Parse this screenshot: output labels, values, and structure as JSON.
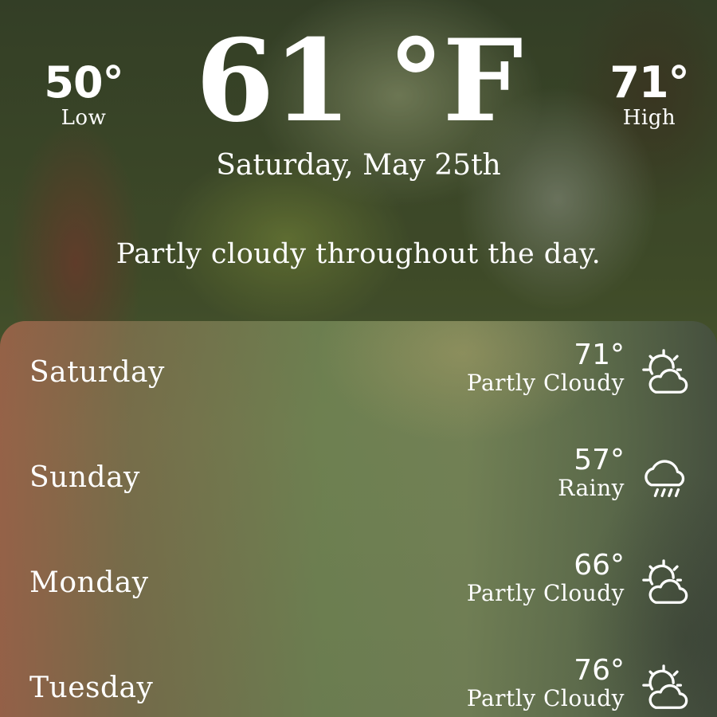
{
  "current": {
    "low": "50°",
    "low_label": "Low",
    "temperature": "61 °F",
    "high": "71°",
    "high_label": "High",
    "date": "Saturday, May 25th",
    "summary": "Partly cloudy throughout the day."
  },
  "forecast": [
    {
      "day": "Saturday",
      "temp": "71°",
      "condition": "Partly Cloudy",
      "icon": "partly-cloudy-icon"
    },
    {
      "day": "Sunday",
      "temp": "57°",
      "condition": "Rainy",
      "icon": "rain-cloud-icon"
    },
    {
      "day": "Monday",
      "temp": "66°",
      "condition": "Partly Cloudy",
      "icon": "partly-cloudy-icon"
    },
    {
      "day": "Tuesday",
      "temp": "76°",
      "condition": "Partly Cloudy",
      "icon": "partly-cloudy-icon"
    }
  ]
}
